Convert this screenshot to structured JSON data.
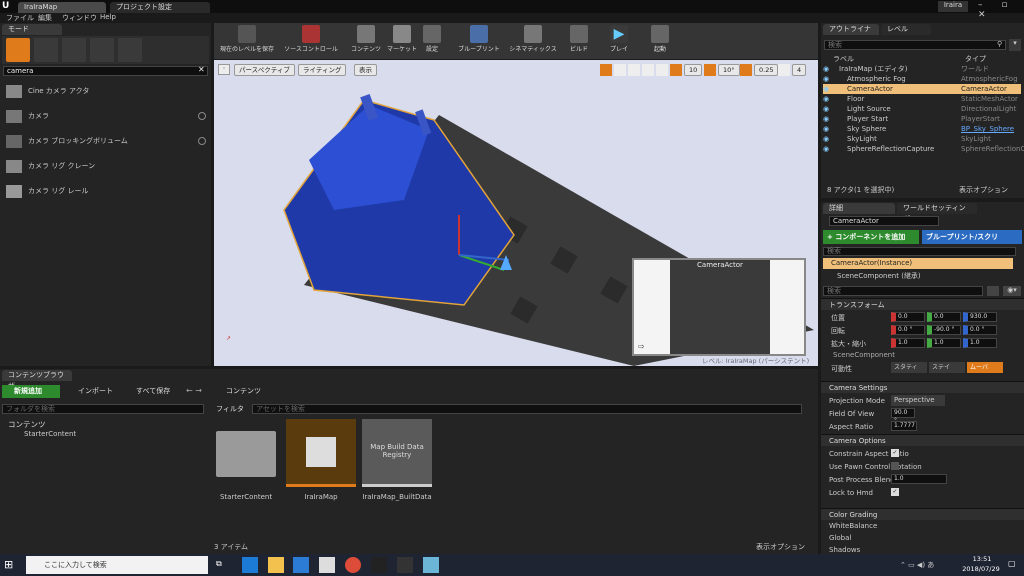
{
  "window": {
    "tab_title": "IraIraMap",
    "tab2": "プロジェクト設定",
    "user": "Iraira"
  },
  "menu": [
    "ファイル",
    "編集",
    "ウィンドウ",
    "Help"
  ],
  "modes": {
    "tab": "モード",
    "search_value": "camera",
    "items": [
      "Cine カメラ アクタ",
      "カメラ",
      "カメラ ブロッキングボリューム",
      "カメラ リグ クレーン",
      "カメラ リグ レール"
    ]
  },
  "toolbar": [
    "現在のレベルを保存",
    "ソースコントロール",
    "コンテンツ",
    "マーケット",
    "設定",
    "ブループリント",
    "シネマティックス",
    "ビルド",
    "プレイ",
    "起動"
  ],
  "viewport": {
    "perspective": "パースペクティブ",
    "lighting": "ライティング",
    "show": "表示",
    "grid": "10",
    "rot": "10°",
    "scale": "0.25",
    "cam": "4",
    "preview_title": "CameraActor",
    "level_label": "レベル: IraIraMap (パーシステント)"
  },
  "outliner": {
    "tab1": "アウトライナ",
    "tab2": "レベル",
    "search_placeholder": "検索",
    "col_label": "ラベル",
    "col_type": "タイプ",
    "rows": [
      [
        "IraIraMap (エディタ)",
        "ワールド"
      ],
      [
        "Atmospheric Fog",
        "AtmosphericFog"
      ],
      [
        "CameraActor",
        "CameraActor"
      ],
      [
        "Floor",
        "StaticMeshActor"
      ],
      [
        "Light Source",
        "DirectionalLight"
      ],
      [
        "Player Start",
        "PlayerStart"
      ],
      [
        "Sky Sphere",
        "BP_Sky_Sphere"
      ],
      [
        "SkyLight",
        "SkyLight"
      ],
      [
        "SphereReflectionCapture",
        "SphereReflectionC"
      ]
    ],
    "count": "8 アクタ(1 を選択中)",
    "view_opt": "表示オプション"
  },
  "details": {
    "tab1": "詳細",
    "tab2": "ワールドセッティング",
    "name": "CameraActor",
    "add_comp": "+ コンポーネントを追加",
    "bp": "ブループリント/スクリ",
    "search_ph": "検索",
    "comp1": "CameraActor(Instance)",
    "comp2": "SceneComponent (継承)",
    "search2": "検索",
    "transform": "トランスフォーム",
    "loc": "位置",
    "rot": "回転",
    "scale": "拡大・縮小",
    "loc_v": [
      "0.0",
      "0.0",
      "930.0"
    ],
    "rot_v": [
      "0.0 °",
      "-90.0 °",
      "0.0 °"
    ],
    "scale_v": [
      "1.0",
      "1.0",
      "1.0"
    ],
    "scene_comp": "SceneComponent",
    "mobility": "可動性",
    "mob": [
      "スタティ",
      "ステイ",
      "ムーバ"
    ],
    "cam_settings": "Camera Settings",
    "proj": "Projection Mode",
    "proj_v": "Perspective",
    "fov": "Field Of View",
    "fov_v": "90.0 °",
    "aspect": "Aspect Ratio",
    "aspect_v": "1.7777",
    "cam_options": "Camera Options",
    "opt1": "Constrain Aspect Ratio",
    "opt2": "Use Pawn Control Rotation",
    "opt3": "Post Process Blend Weight",
    "opt3_v": "1.0",
    "opt4": "Lock to Hmd",
    "grading": "Color Grading",
    "g1": "WhiteBalance",
    "g2": "Global",
    "g3": "Shadows"
  },
  "content": {
    "tab": "コンテンツブラウザ",
    "add": "新規追加",
    "import": "インポート",
    "save_all": "すべて保存",
    "path": "コンテンツ",
    "filter": "フィルタ",
    "asset_ph": "アセットを検索",
    "folder_ph": "フォルダを検索",
    "tree_root": "コンテンツ",
    "tree_child": "StarterContent",
    "assets": [
      "StarterContent",
      "IraIraMap",
      "IraIraMap_BuiltData"
    ],
    "registry": "Map Build Data Registry",
    "count": "3 アイテム",
    "view_opt": "表示オプション"
  },
  "taskbar": {
    "search": "ここに入力して検索",
    "time": "13:51",
    "date": "2018/07/29"
  }
}
